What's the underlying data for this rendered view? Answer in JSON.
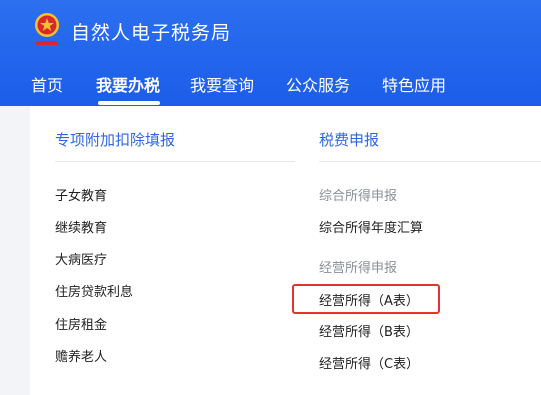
{
  "header": {
    "title": "自然人电子税务局",
    "logo_icon": "tax-emblem-icon"
  },
  "nav": {
    "items": [
      {
        "label": "首页"
      },
      {
        "label": "我要办税",
        "active": true
      },
      {
        "label": "我要查询"
      },
      {
        "label": "公众服务"
      },
      {
        "label": "特色应用"
      }
    ]
  },
  "dropdown": {
    "left": {
      "title": "专项附加扣除填报",
      "items": [
        "子女教育",
        "继续教育",
        "大病医疗",
        "住房贷款利息",
        "住房租金",
        "赡养老人"
      ]
    },
    "right": {
      "title": "税费申报",
      "group1_label": "综合所得申报",
      "group1_items": [
        "综合所得年度汇算"
      ],
      "group2_label": "经营所得申报",
      "group2_items": [
        "经营所得（A表）",
        "经营所得（B表）",
        "经营所得（C表）"
      ]
    }
  },
  "colors": {
    "header_bg": "#1c5de9",
    "section_title": "#2e68e8",
    "highlight": "#e8312a"
  }
}
